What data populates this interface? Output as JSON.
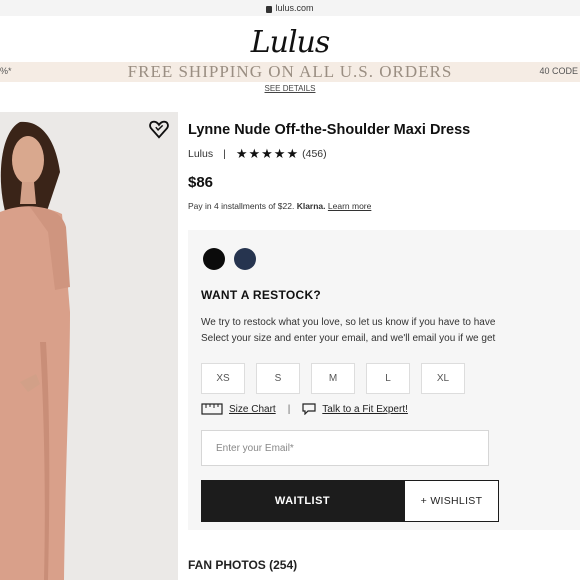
{
  "browser": {
    "url": "lulus.com"
  },
  "site": {
    "logo": "Lulus"
  },
  "promo": {
    "left_text": "%*",
    "text": "FREE SHIPPING ON ALL U.S. ORDERS",
    "right_text": "40 CODE",
    "details_link": "SEE DETAILS"
  },
  "product": {
    "title": "Lynne Nude Off-the-Shoulder Maxi Dress",
    "brand": "Lulus",
    "separator": "|",
    "stars": "★★★★★",
    "review_count": "(456)",
    "rating": 5,
    "price": "$86",
    "installments": {
      "text": "Pay in 4 installments of $22.",
      "provider": "Klarna.",
      "link": "Learn more"
    }
  },
  "colors": {
    "swatches": [
      {
        "name": "black-swatch",
        "hex": "#0b0b0b"
      },
      {
        "name": "navy-swatch",
        "hex": "#26344f"
      }
    ],
    "dress": "#d9a08a",
    "accent": "#1c1c1c"
  },
  "restock": {
    "heading": "WANT A RESTOCK?",
    "line1": "We try to restock what you love, so let us know if you have to have",
    "line2": "Select your size and enter your email, and we'll email you if we get",
    "sizes": [
      "XS",
      "S",
      "M",
      "L",
      "XL"
    ],
    "size_chart": "Size Chart",
    "separator": "|",
    "fit_expert": "Talk to a Fit Expert!",
    "email_placeholder": "Enter your Email*",
    "waitlist_label": "WAITLIST",
    "wishlist_label": "+ WISHLIST"
  },
  "fan_photos": {
    "label": "FAN PHOTOS (254)"
  },
  "icons": [
    "lock-icon",
    "heart-icon",
    "star-icon",
    "ruler-icon",
    "chat-icon"
  ]
}
